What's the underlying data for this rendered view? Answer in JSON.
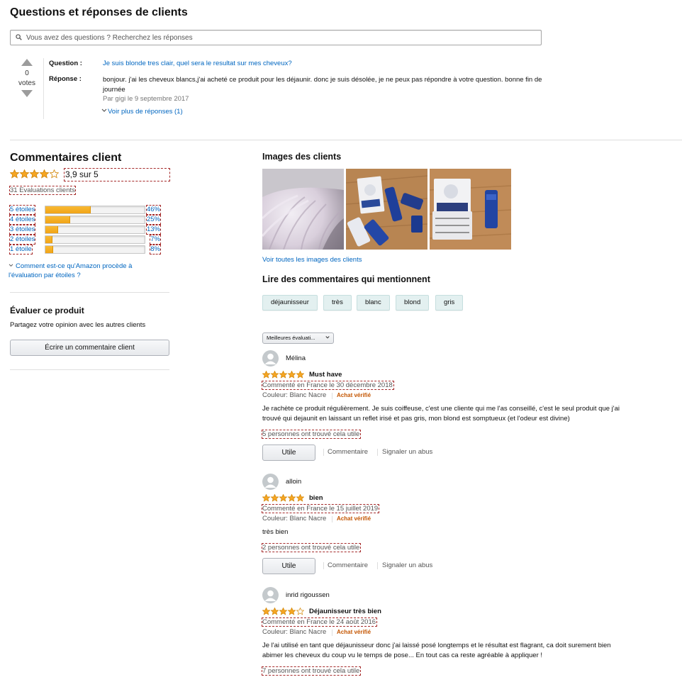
{
  "qa": {
    "title": "Questions et réponses de clients",
    "search_placeholder": "Vous avez des questions ? Recherchez les réponses",
    "votes_count": "0",
    "votes_label": "votes",
    "question_label": "Question :",
    "answer_label": "Réponse :",
    "question": "Je suis blonde tres clair, quel sera le resultat sur mes cheveux?",
    "answer": "bonjour. j'ai les cheveux blancs,j'ai acheté ce produit pour les déjaunir. donc je suis désolée, je ne peux pas répondre à votre question. bonne fin de journée",
    "byline": "Par gigi le 9 septembre 2017",
    "more_link": "Voir plus de réponses (1)"
  },
  "ratings": {
    "title": "Commentaires client",
    "average_text": "3,9 sur 5",
    "average_stars": 3.9,
    "count_text": "31 Evaluations clients",
    "histogram": [
      {
        "label": "5 étoiles",
        "percent": "46%",
        "value": 46
      },
      {
        "label": "4 étoiles",
        "percent": "25%",
        "value": 25
      },
      {
        "label": "3 étoiles",
        "percent": "13%",
        "value": 13
      },
      {
        "label": "2 étoiles",
        "percent": "7%",
        "value": 7
      },
      {
        "label": "1 étoile",
        "percent": "8%",
        "value": 8
      }
    ],
    "how_link": "Comment est-ce qu'Amazon procède à l'évaluation par étoiles ?"
  },
  "evaluate": {
    "title": "Évaluer ce produit",
    "subtitle": "Partagez votre opinion avec les autres clients",
    "button": "Écrire un commentaire client"
  },
  "customer_images": {
    "title": "Images des clients",
    "see_all": "Voir toutes les images des clients"
  },
  "mentions": {
    "title": "Lire des commentaires qui mentionnent",
    "chips": [
      "déjaunisseur",
      "très",
      "blanc",
      "blond",
      "gris"
    ]
  },
  "sort": {
    "selected": "Meilleures évaluati..."
  },
  "reviews": [
    {
      "name": "Mélina",
      "stars": 5,
      "title": "Must have",
      "date": "Commenté en France le 30 décembre 2018",
      "variant": "Couleur: Blanc Nacre",
      "verified": "Achat vérifié",
      "body": "Je rachète ce produit régulièrement. Je suis coiffeuse, c'est une cliente qui me l'as conseillé, c'est le seul produit que j'ai trouvé qui dejaunit en laissant un reflet irisé et pas gris, mon blond est somptueux (et l'odeur est divine)",
      "helpful": "5 personnes ont trouvé cela utile",
      "useful_btn": "Utile",
      "comment": "Commentaire",
      "report": "Signaler un abus"
    },
    {
      "name": "alloin",
      "stars": 5,
      "title": "bien",
      "date": "Commenté en France le 15 juillet 2019",
      "variant": "Couleur: Blanc Nacre",
      "verified": "Achat vérifié",
      "body": "très bien",
      "helpful": "2 personnes ont trouvé cela utile",
      "useful_btn": "Utile",
      "comment": "Commentaire",
      "report": "Signaler un abus"
    },
    {
      "name": "inrid rigoussen",
      "stars": 4,
      "title": "Déjaunisseur très bien",
      "date": "Commenté en France le 24 août 2016",
      "variant": "Couleur: Blanc Nacre",
      "verified": "Achat vérifié",
      "body": "Je l'ai utilisé en tant que déjaunisseur donc j'ai laissé posé longtemps et le résultat est flagrant, ca doit surement bien abimer les cheveux du coup vu le temps de pose... En tout cas ca reste agréable à appliquer !",
      "helpful": "7 personnes ont trouvé cela utile"
    }
  ],
  "colors": {
    "star": "#f6a623",
    "star_outline": "#d58b0f",
    "link": "#0066c0",
    "verified": "#c45500",
    "bar_fill": "#f1a417"
  }
}
